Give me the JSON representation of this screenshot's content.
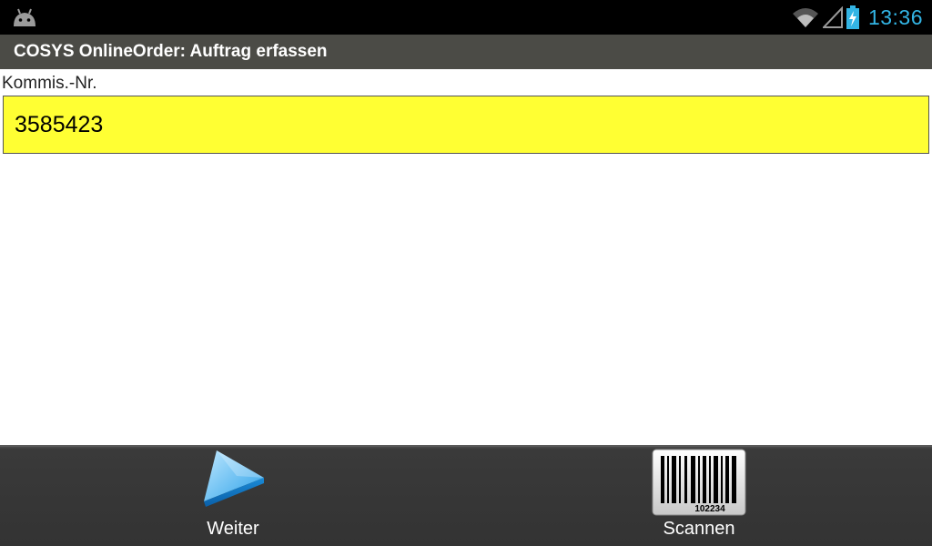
{
  "status_bar": {
    "time": "13:36",
    "icons": [
      "android-icon",
      "wifi-icon",
      "signal-icon",
      "battery-charging-icon"
    ],
    "accent_color": "#33b5e5"
  },
  "app": {
    "title": "COSYS OnlineOrder: Auftrag erfassen"
  },
  "form": {
    "label": "Kommis.-Nr.",
    "value": "3585423",
    "field_color": "#ffff33"
  },
  "bottom_bar": {
    "buttons": [
      {
        "label": "Weiter",
        "icon": "play-arrow-icon"
      },
      {
        "label": "Scannen",
        "icon": "barcode-icon",
        "barcode_text": "102234"
      }
    ]
  }
}
